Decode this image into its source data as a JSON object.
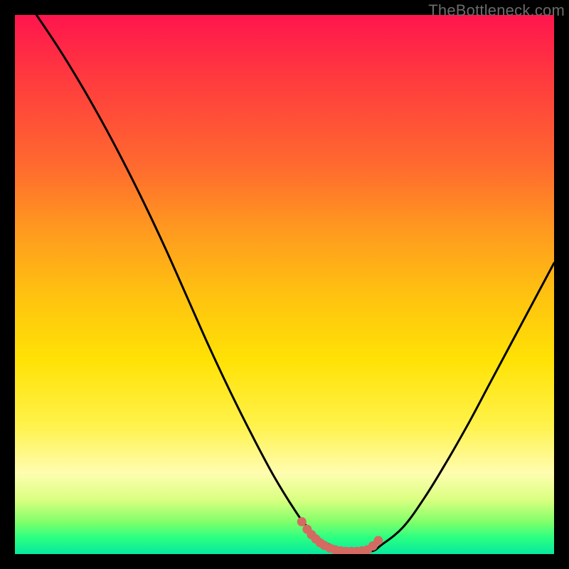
{
  "watermark": "TheBottleneck.com",
  "colors": {
    "frame": "#000000",
    "curve": "#000000",
    "marker": "#d46a62",
    "gradient_stops": [
      "#ff154e",
      "#ff3b3e",
      "#ff6a2f",
      "#ff9a1f",
      "#ffc210",
      "#ffe205",
      "#fff24a",
      "#fffdb0",
      "#d9ff80",
      "#82ff6a",
      "#2aff82",
      "#08e89e"
    ]
  },
  "chart_data": {
    "type": "line",
    "title": "",
    "xlabel": "",
    "ylabel": "",
    "xlim": [
      0,
      100
    ],
    "ylim": [
      0,
      100
    ],
    "grid": false,
    "legend": null,
    "series": [
      {
        "name": "curve",
        "x": [
          4,
          8,
          12,
          16,
          20,
          24,
          28,
          32,
          36,
          40,
          44,
          48,
          52,
          54,
          56,
          58,
          62,
          66,
          68,
          72,
          76,
          80,
          84,
          88,
          92,
          96,
          100
        ],
        "y": [
          100,
          94,
          87.5,
          80.5,
          73,
          65,
          56.5,
          47.5,
          38.5,
          30,
          22,
          14.5,
          8,
          5.3,
          3.3,
          1.9,
          0.5,
          0.5,
          1.7,
          5,
          10.5,
          17,
          24,
          31.5,
          39,
          46.5,
          54
        ]
      }
    ],
    "markers": {
      "name": "bottom-dots",
      "color": "#d46a62",
      "x": [
        53.2,
        54.2,
        55.0,
        55.8,
        56.6,
        57.4,
        58.4,
        59.4,
        60.4,
        61.4,
        62.4,
        63.4,
        64.4,
        65.4,
        66.4,
        67.4
      ],
      "y": [
        6.0,
        4.6,
        3.6,
        2.8,
        2.1,
        1.6,
        1.1,
        0.8,
        0.6,
        0.5,
        0.5,
        0.5,
        0.6,
        0.8,
        1.5,
        2.5
      ]
    }
  }
}
